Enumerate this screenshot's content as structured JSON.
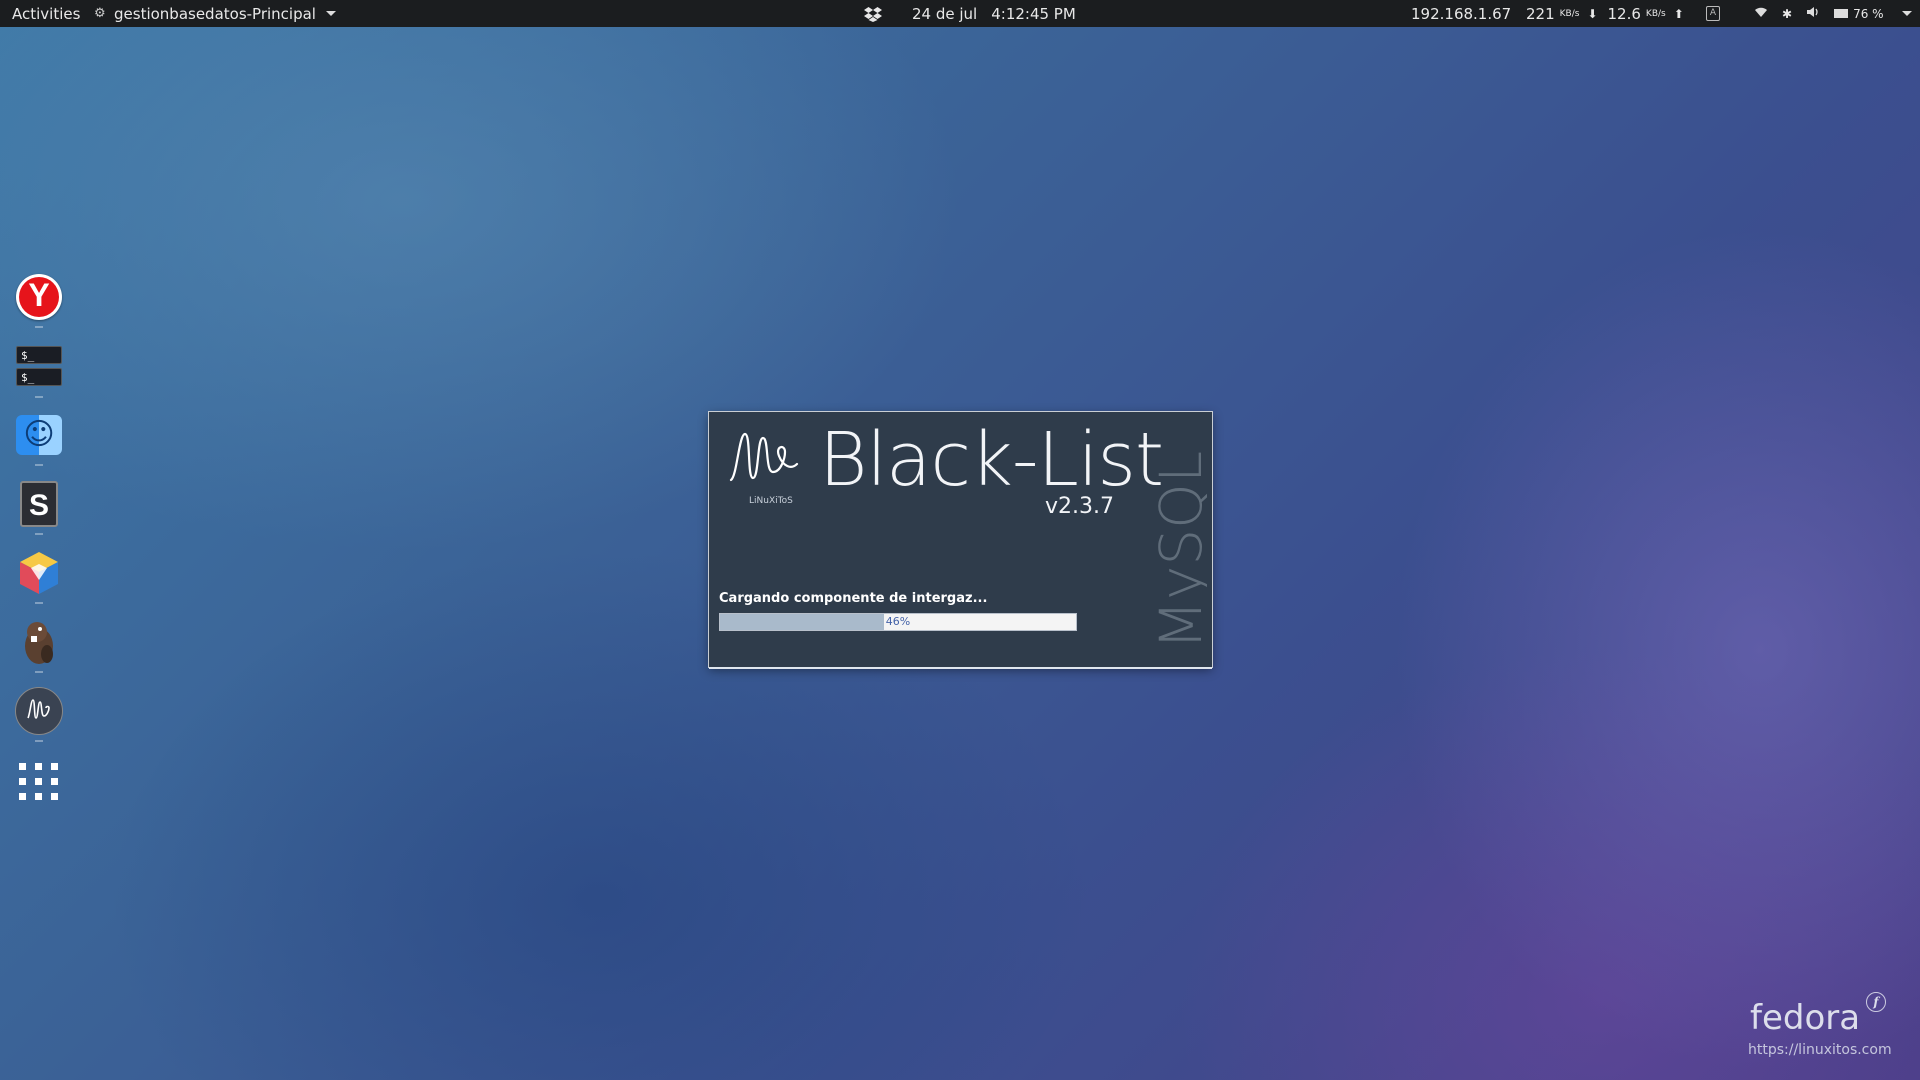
{
  "topbar": {
    "activities": "Activities",
    "app_name": "gestionbasedatos-Principal",
    "date": "24 de jul",
    "time": "4:12:45 PM",
    "ip": "192.168.1.67",
    "down_rate": "221",
    "down_unit": "KB/s",
    "up_rate": "12.6",
    "up_unit": "KB/s",
    "keyboard_indicator": "A",
    "battery": "76 %"
  },
  "dock": {
    "items": [
      {
        "name": "Yandex Browser",
        "icon": "yandex-icon"
      },
      {
        "name": "Terminal",
        "icon": "terminal-icon"
      },
      {
        "name": "Files",
        "icon": "finder-icon"
      },
      {
        "name": "Sublime Text",
        "icon": "sublime-icon"
      },
      {
        "name": "NetBeans",
        "icon": "netbeans-icon"
      },
      {
        "name": "DBeaver",
        "icon": "dbeaver-icon"
      },
      {
        "name": "Black-List",
        "icon": "blacklist-icon"
      },
      {
        "name": "Show Applications",
        "icon": "app-grid-icon"
      }
    ],
    "terminal_prompt": "$_",
    "sublime_letter": "S",
    "yandex_letter": "Y"
  },
  "splash": {
    "logo_subtext": "LiNuXiToS",
    "title": "Black-List",
    "version": "v2.3.7",
    "vertical_text": "MySQL",
    "status": "Cargando componente de intergaz...",
    "progress_percent": 46,
    "progress_label": "46%"
  },
  "watermark": {
    "brand": "fedora",
    "url": "https://linuxitos.com"
  },
  "colors": {
    "splash_bg": "#2f3c4b",
    "progress_fill": "#a9bacb",
    "topbar_bg": "#1b1d1f"
  }
}
